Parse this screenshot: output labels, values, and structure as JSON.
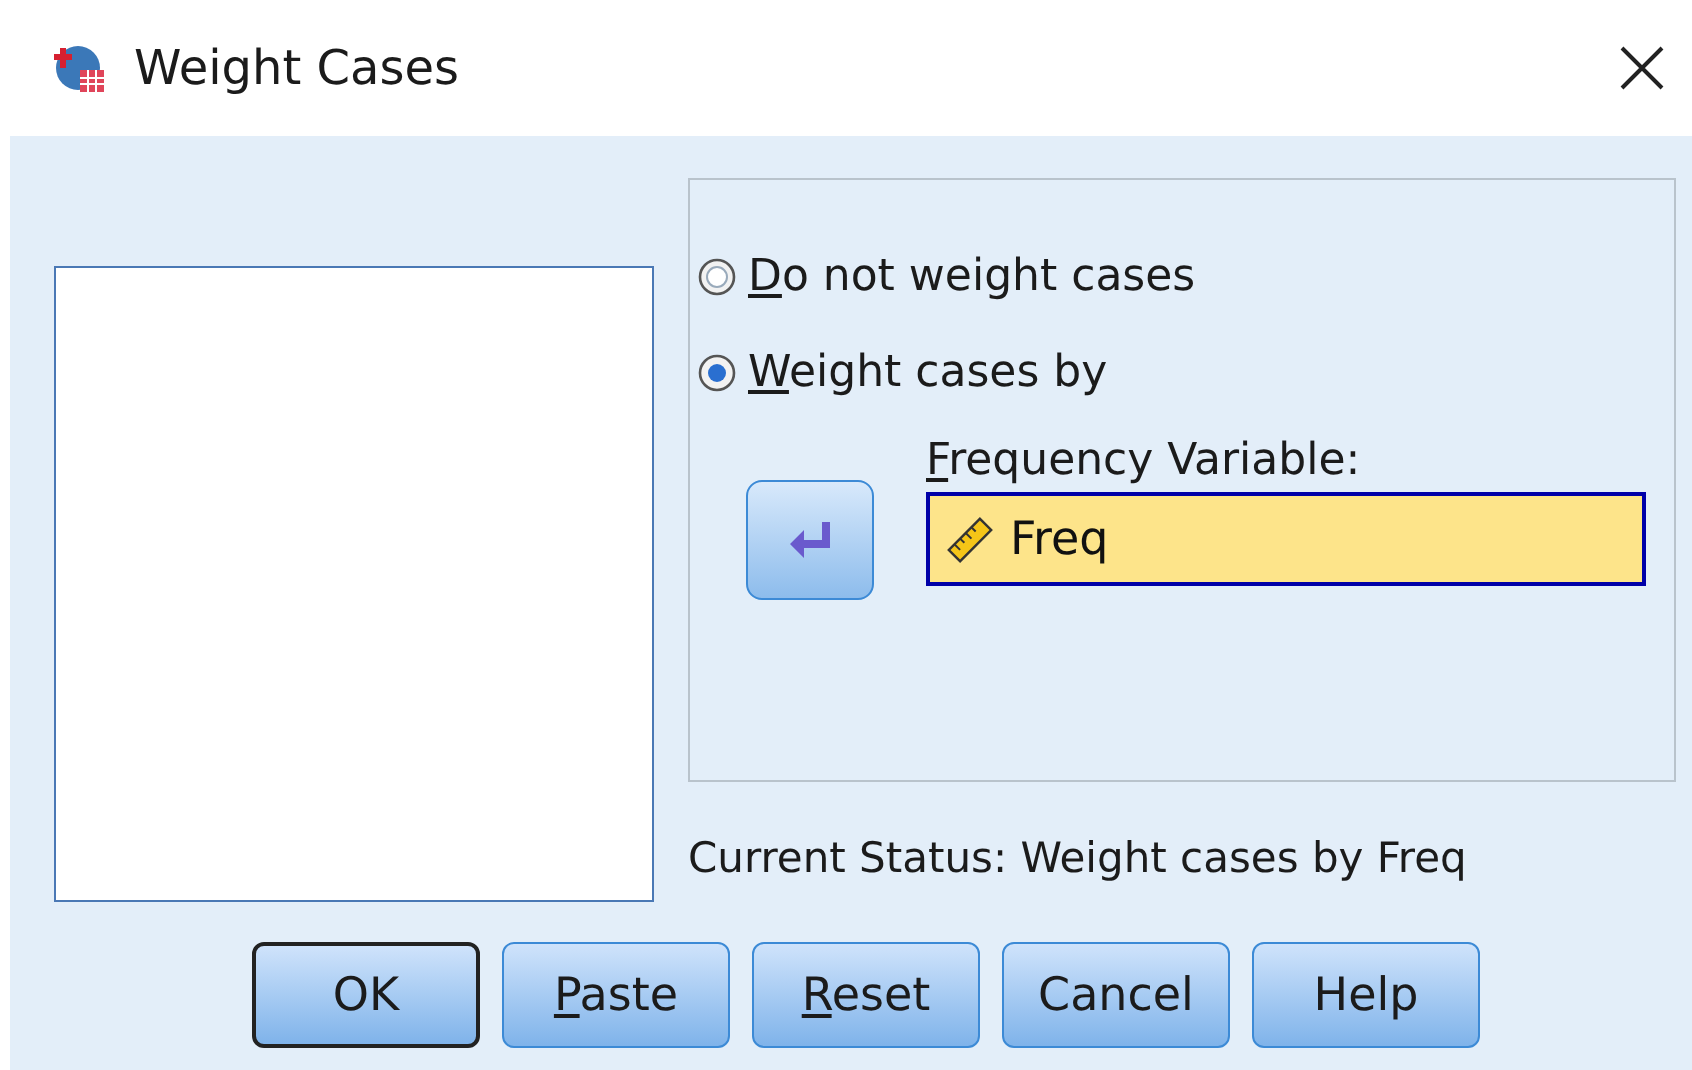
{
  "window": {
    "title": "Weight Cases"
  },
  "options": [
    {
      "label": "Do not weight cases",
      "underline_first": true,
      "selected": false
    },
    {
      "label": "Weight cases by",
      "underline_first": true,
      "selected": true
    }
  ],
  "frequency_variable": {
    "label": "Frequency Variable:",
    "underline_first": true,
    "value": "Freq",
    "focused": true
  },
  "status": "Current Status: Weight cases by Freq",
  "buttons": [
    {
      "label": "OK",
      "underline_first": false,
      "default": true
    },
    {
      "label": "Paste",
      "underline_first": true,
      "default": false
    },
    {
      "label": "Reset",
      "underline_first": true,
      "default": false
    },
    {
      "label": "Cancel",
      "underline_first": false,
      "default": false
    },
    {
      "label": "Help",
      "underline_first": false,
      "default": false
    }
  ]
}
